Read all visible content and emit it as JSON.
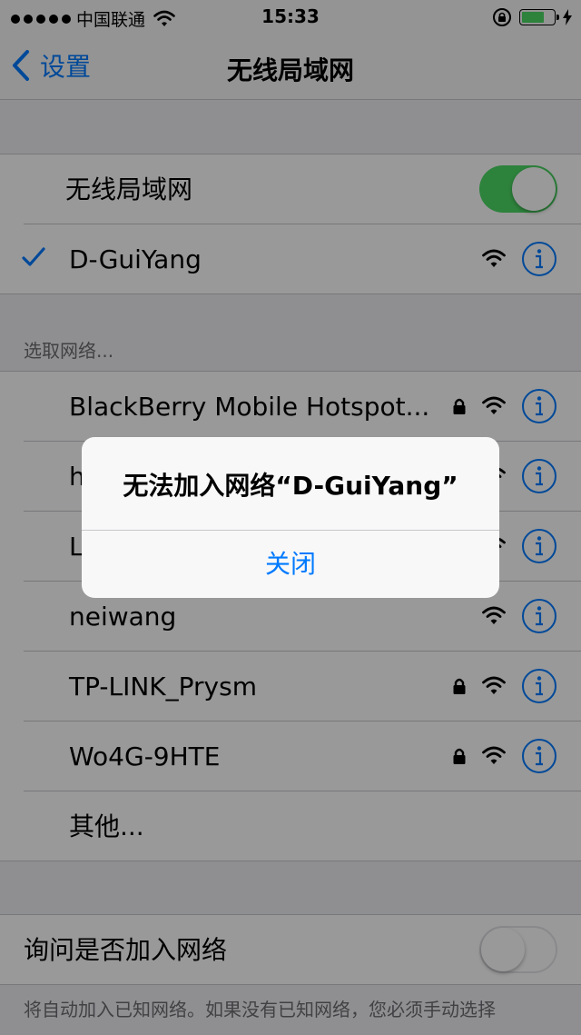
{
  "status_bar": {
    "carrier": "中国联通",
    "time": "15:33",
    "signal_dots": [
      true,
      true,
      true,
      true,
      true
    ],
    "battery_level": 0.7,
    "battery_color": "#4cd964"
  },
  "nav": {
    "back_label": "设置",
    "title": "无线局域网"
  },
  "wifi_toggle": {
    "label": "无线局域网",
    "on": true
  },
  "connected_network": {
    "name": "D-GuiYang",
    "locked": false
  },
  "section_header": "选取网络...",
  "networks": [
    {
      "name": "BlackBerry Mobile Hotspot...",
      "locked": true
    },
    {
      "name": "h",
      "locked": false
    },
    {
      "name": "L",
      "locked": false
    },
    {
      "name": "neiwang",
      "locked": false
    },
    {
      "name": "TP-LINK_Prysm",
      "locked": true
    },
    {
      "name": "Wo4G-9HTE",
      "locked": true
    }
  ],
  "other_label": "其他...",
  "ask_join": {
    "label": "询问是否加入网络",
    "on": false
  },
  "footer_text": "将自动加入已知网络。如果没有已知网络，您必须手动选择",
  "alert": {
    "title": "无法加入网络“D-GuiYang”",
    "button": "关闭"
  },
  "colors": {
    "accent": "#007aff",
    "toggle_on": "#4cd964",
    "background": "#efeff4"
  }
}
